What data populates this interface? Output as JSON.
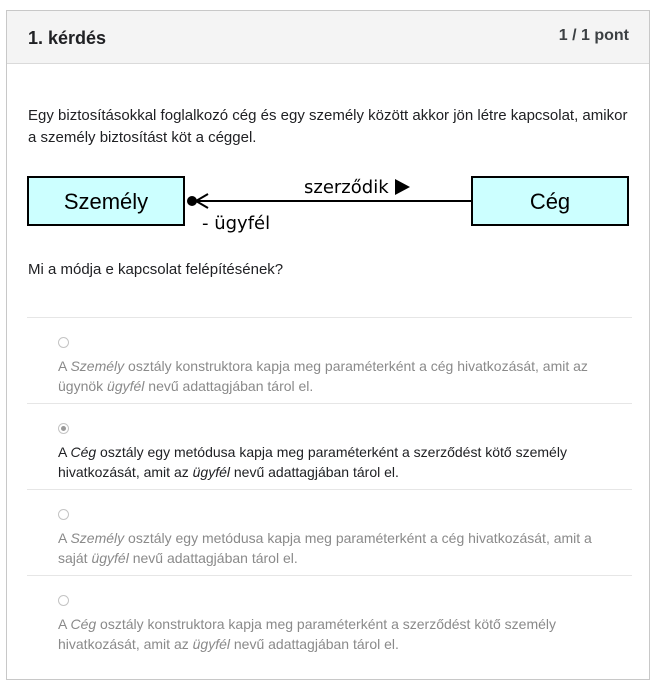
{
  "question": {
    "title": "1. kérdés",
    "points": "1 / 1 pont",
    "text": "Egy biztosításokkal foglalkozó cég és egy személy között akkor jön létre kapcsolat, amikor a személy biztosítást köt a céggel.",
    "prompt": "Mi a módja e kapcsolat felépítésének?"
  },
  "diagram": {
    "left_class": "Személy",
    "right_class": "Cég",
    "association_label": "szerződik",
    "role_label": "- ügyfél",
    "box_fill": "#ccffff"
  },
  "options": [
    {
      "selected": false,
      "parts": [
        {
          "t": "A ",
          "i": false
        },
        {
          "t": "Személy",
          "i": true
        },
        {
          "t": " osztály konstruktora kapja meg paraméterként a cég hivatkozását, amit az ügynök ",
          "i": false
        },
        {
          "t": "ügyfél",
          "i": true
        },
        {
          "t": " nevű adattagjában tárol el.",
          "i": false
        }
      ]
    },
    {
      "selected": true,
      "parts": [
        {
          "t": "A ",
          "i": false
        },
        {
          "t": "Cég",
          "i": true
        },
        {
          "t": " osztály egy metódusa kapja meg paraméterként a szerződést kötő személy hivatkozását, amit az ",
          "i": false
        },
        {
          "t": "ügyfél",
          "i": true
        },
        {
          "t": " nevű adattagjában tárol el.",
          "i": false
        }
      ]
    },
    {
      "selected": false,
      "parts": [
        {
          "t": "A ",
          "i": false
        },
        {
          "t": "Személy",
          "i": true
        },
        {
          "t": " osztály egy metódusa kapja meg paraméterként a cég hivatkozását, amit a saját ",
          "i": false
        },
        {
          "t": "ügyfél",
          "i": true
        },
        {
          "t": " nevű adattagjában tárol el.",
          "i": false
        }
      ]
    },
    {
      "selected": false,
      "parts": [
        {
          "t": "A ",
          "i": false
        },
        {
          "t": "Cég",
          "i": true
        },
        {
          "t": " osztály konstruktora kapja meg paraméterként a szerződést kötő személy hivatkozását, amit az ",
          "i": false
        },
        {
          "t": "ügyfél",
          "i": true
        },
        {
          "t": " nevű adattagjában tárol el.",
          "i": false
        }
      ]
    }
  ]
}
